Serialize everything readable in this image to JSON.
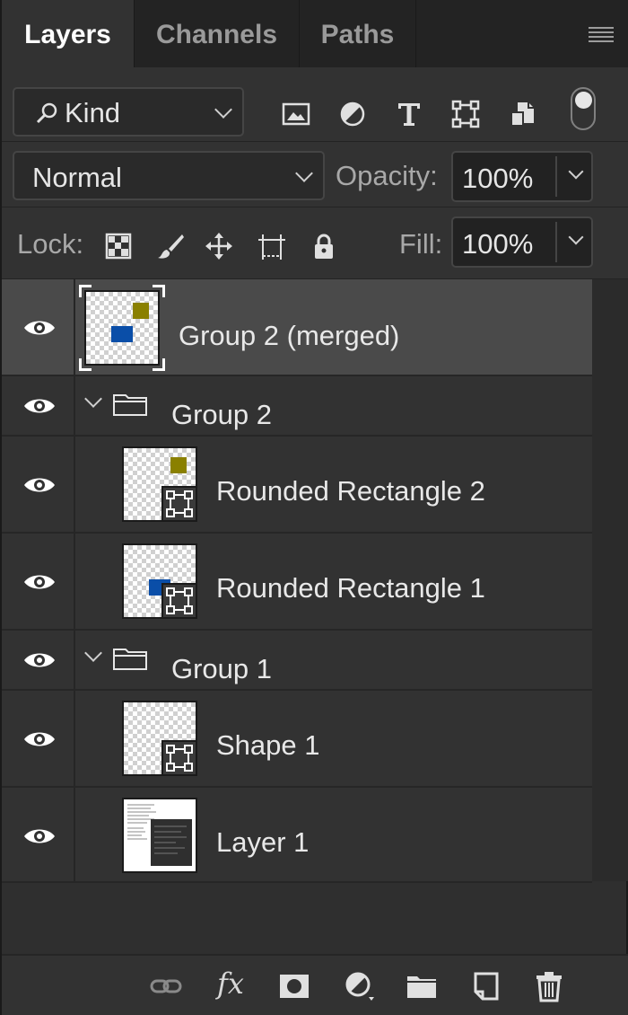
{
  "tabs": [
    {
      "label": "Layers",
      "active": true
    },
    {
      "label": "Channels",
      "active": false
    },
    {
      "label": "Paths",
      "active": false
    }
  ],
  "filter": {
    "kind_label": "Kind",
    "icons": [
      "pixel-layer-filter-icon",
      "adjustment-layer-filter-icon",
      "type-layer-filter-icon",
      "shape-layer-filter-icon",
      "smart-object-filter-icon"
    ],
    "toggle_on": true
  },
  "blend": {
    "mode": "Normal",
    "opacity_label": "Opacity:",
    "opacity": "100%"
  },
  "lock": {
    "label": "Lock:",
    "fill_label": "Fill:",
    "fill": "100%"
  },
  "layers": [
    {
      "name": "Group 2 (merged)",
      "type": "smart-object",
      "selected": true
    },
    {
      "name": "Group 2",
      "type": "group",
      "expanded": true
    },
    {
      "name": "Rounded Rectangle 2",
      "type": "shape"
    },
    {
      "name": "Rounded Rectangle 1",
      "type": "shape"
    },
    {
      "name": "Group 1",
      "type": "group",
      "expanded": true
    },
    {
      "name": "Shape 1",
      "type": "shape"
    },
    {
      "name": "Layer 1",
      "type": "pixel"
    }
  ],
  "colors": {
    "panel_bg": "#323232",
    "selected_row": "#4a4a4a",
    "olive": "#8a8000",
    "blue": "#0a4ea8"
  },
  "footer_icons": [
    "link-layers-icon",
    "fx-icon",
    "add-mask-icon",
    "adjustment-layer-icon",
    "new-group-icon",
    "new-layer-icon",
    "delete-layer-icon"
  ]
}
